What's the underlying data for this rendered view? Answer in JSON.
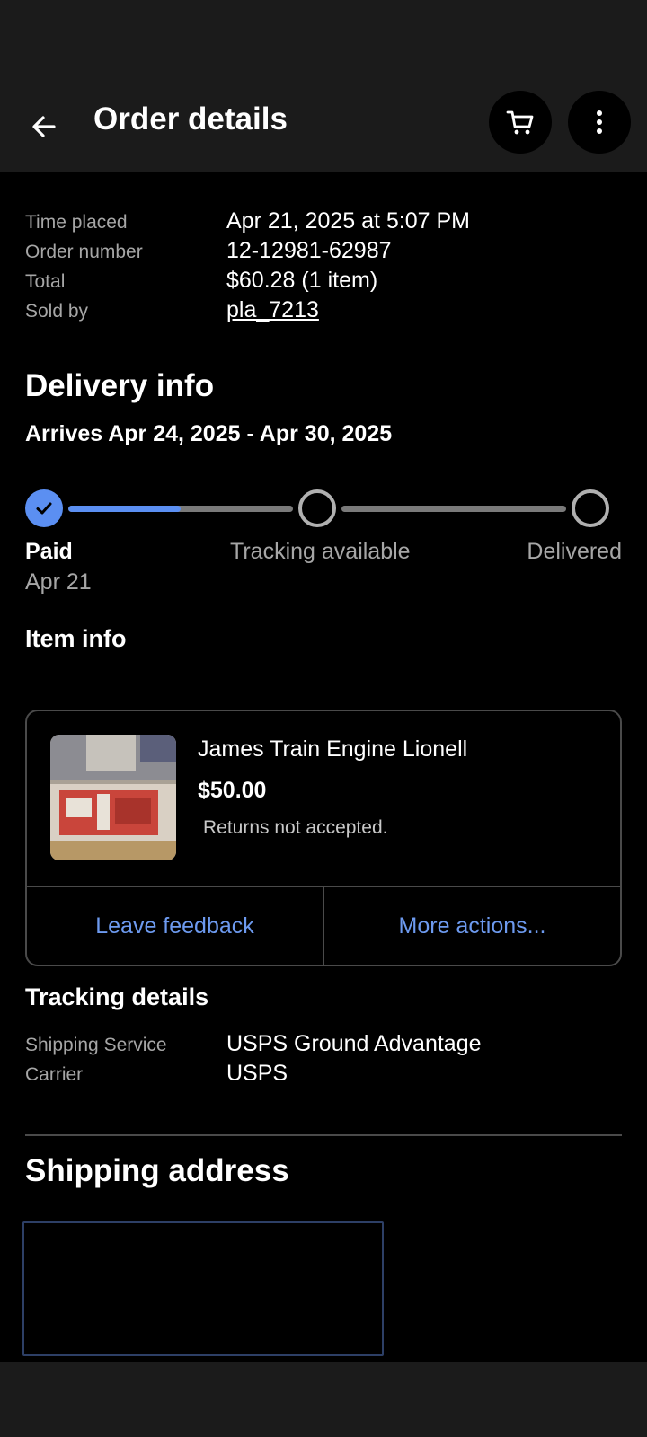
{
  "app_bar": {
    "title": "Order details"
  },
  "order_summary": [
    {
      "label": "Time placed",
      "value": "Apr 21, 2025 at 5:07 PM"
    },
    {
      "label": "Order number",
      "value": "12-12981-62987"
    },
    {
      "label": "Total",
      "value": "$60.28 (1 item)"
    },
    {
      "label": "Sold by",
      "value": "pla_7213"
    }
  ],
  "delivery": {
    "heading": "Delivery info",
    "arrives": "Arrives Apr 24, 2025 - Apr 30, 2025",
    "progress_fraction": 0.25,
    "steps": [
      {
        "label": "Paid",
        "date": "Apr 21",
        "done": true
      },
      {
        "label": "Tracking available",
        "done": false
      },
      {
        "label": "Delivered",
        "done": false
      }
    ]
  },
  "item_info": {
    "heading": "Item info",
    "item": {
      "title": "James Train Engine Lionell",
      "price": "$50.00",
      "returns": "Returns not accepted."
    },
    "actions": {
      "feedback": "Leave feedback",
      "more": "More actions..."
    }
  },
  "tracking": {
    "heading": "Tracking details",
    "rows": [
      {
        "label": "Shipping Service",
        "value": "USPS Ground Advantage"
      },
      {
        "label": "Carrier",
        "value": "USPS"
      }
    ]
  },
  "shipping_address": {
    "heading": "Shipping address"
  },
  "colors": {
    "accent": "#5b8ff2",
    "link": "#6d9aef",
    "background": "#000000",
    "bar": "#1b1b1b"
  },
  "icons": {
    "back": "arrow-left-icon",
    "cart": "cart-icon",
    "more": "more-vertical-icon",
    "check": "check-icon"
  }
}
